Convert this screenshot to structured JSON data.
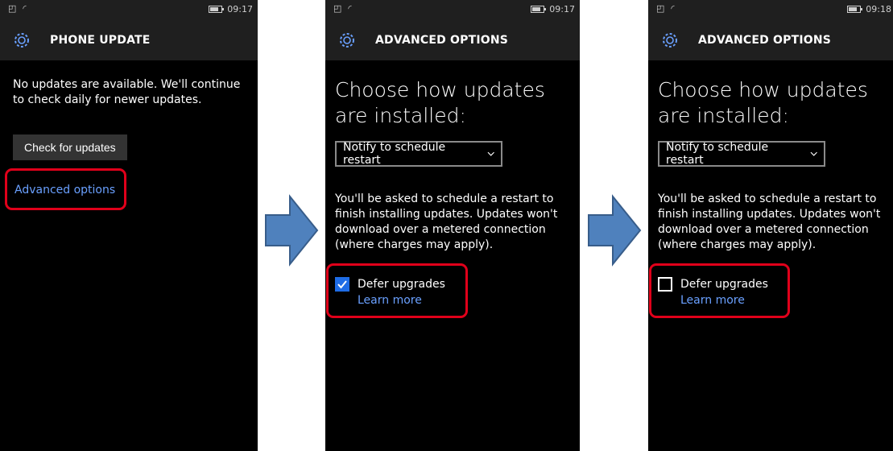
{
  "colors": {
    "highlight": "#e0001a",
    "accent": "#1e6ce6",
    "link": "#6aa0ff",
    "arrow": "#4f81bd"
  },
  "screens": [
    {
      "status": {
        "time": "09:17"
      },
      "header": {
        "title": "PHONE UPDATE",
        "icon": "gear-icon"
      },
      "message": "No updates are available. We'll continue to check daily for newer updates.",
      "check_button": "Check for updates",
      "advanced_link": "Advanced options"
    },
    {
      "status": {
        "time": "09:17"
      },
      "header": {
        "title": "ADVANCED OPTIONS",
        "icon": "gear-icon"
      },
      "heading": "Choose how updates are installed:",
      "dropdown_value": "Notify to schedule restart",
      "description": "You'll be asked to schedule a restart to finish installing updates. Updates won't download over a metered connection (where charges may apply).",
      "defer": {
        "label": "Defer upgrades",
        "checked": true,
        "learn_more": "Learn more"
      }
    },
    {
      "status": {
        "time": "09:18"
      },
      "header": {
        "title": "ADVANCED OPTIONS",
        "icon": "gear-icon"
      },
      "heading": "Choose how updates are installed:",
      "dropdown_value": "Notify to schedule restart",
      "description": "You'll be asked to schedule a restart to finish installing updates. Updates won't download over a metered connection (where charges may apply).",
      "defer": {
        "label": "Defer upgrades",
        "checked": false,
        "learn_more": "Learn more"
      }
    }
  ]
}
